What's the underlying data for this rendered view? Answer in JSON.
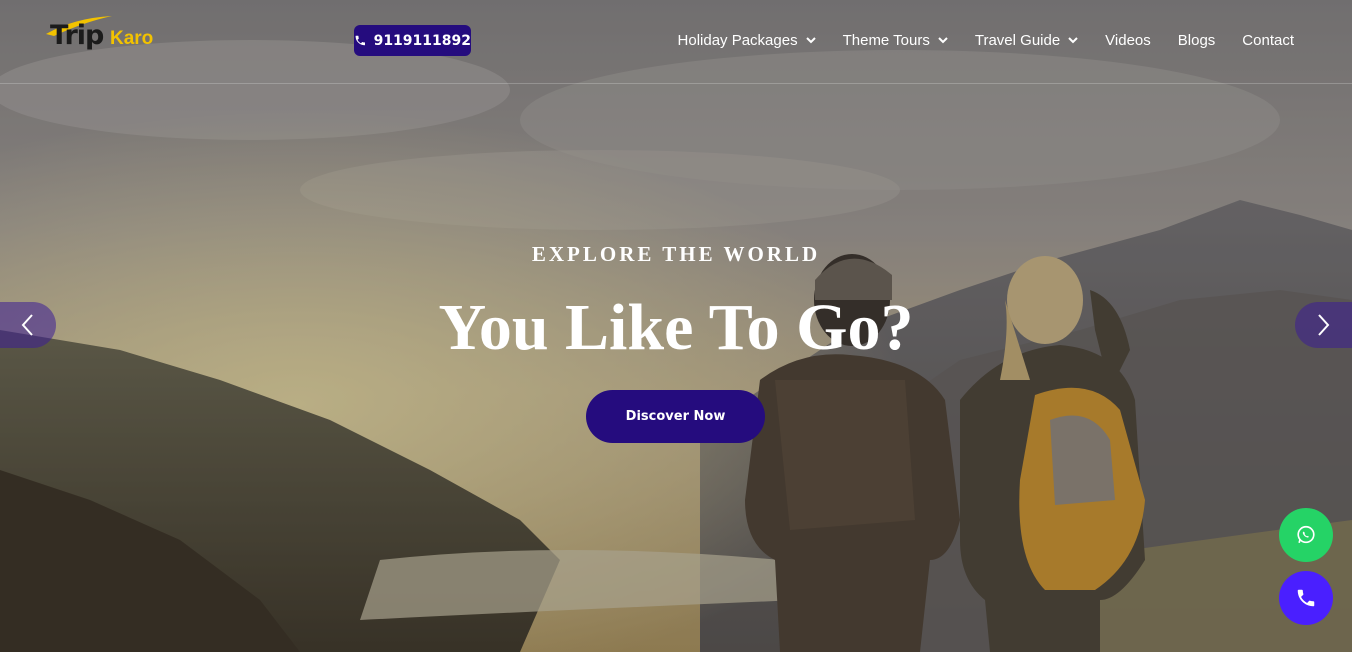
{
  "brand": {
    "logo_trip": "Trip",
    "logo_karo": "Karo",
    "accent_color": "#f2c200",
    "primary_color": "#250c7e"
  },
  "header": {
    "phone_number": "9119111892",
    "phone_icon": "phone-icon"
  },
  "nav": {
    "items": [
      {
        "label": "Holiday Packages",
        "has_dropdown": true
      },
      {
        "label": "Theme Tours",
        "has_dropdown": true
      },
      {
        "label": "Travel Guide",
        "has_dropdown": true
      },
      {
        "label": "Videos",
        "has_dropdown": false
      },
      {
        "label": "Blogs",
        "has_dropdown": false
      },
      {
        "label": "Contact",
        "has_dropdown": false
      }
    ]
  },
  "hero": {
    "subtitle": "EXPLORE THE WORLD",
    "title": "You Like To Go?",
    "cta_label": "Discover Now",
    "prev_icon": "chevron-left-icon",
    "next_icon": "chevron-right-icon"
  },
  "floating": {
    "whatsapp_icon": "whatsapp-icon",
    "whatsapp_color": "#25d366",
    "call_icon": "phone-icon",
    "call_color": "#4a1fff"
  }
}
